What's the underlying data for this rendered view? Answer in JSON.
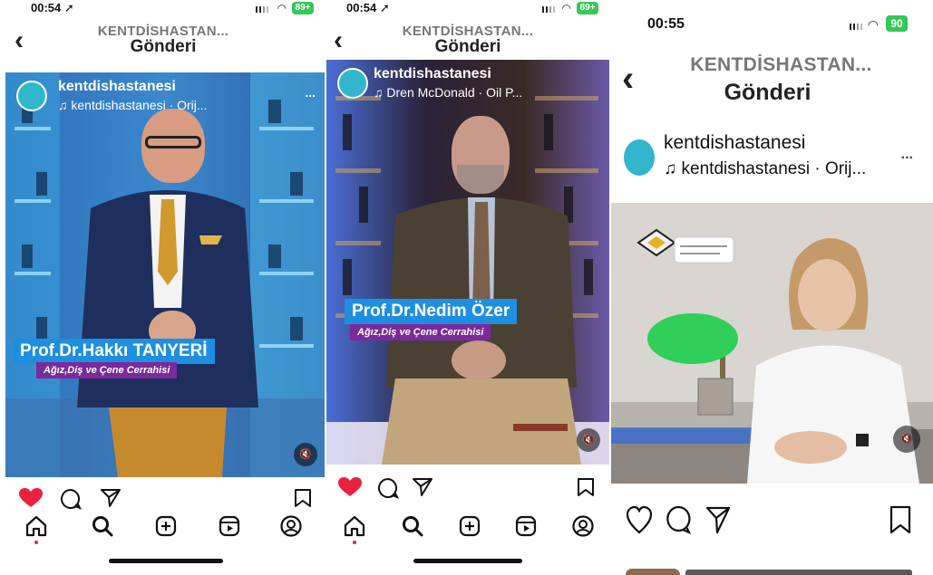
{
  "panel1": {
    "status": {
      "time": "00:54 ➚",
      "battery": "89+"
    },
    "nav": {
      "account": "KENTDİSHASTAN...",
      "title": "Gönderi"
    },
    "post": {
      "username": "kentdishastanesi",
      "audio": "♫ kentdishastanesi · Orij...",
      "more": "...",
      "name_tag": "Prof.Dr.Hakkı  TANYERİ",
      "subtitle": "Ağız,Diş ve Çene  Cerrahisi",
      "mute": "🔇"
    }
  },
  "panel2": {
    "status": {
      "time": "00:54 ➚",
      "battery": "89+"
    },
    "nav": {
      "account": "KENTDİSHASTAN...",
      "title": "Gönderi"
    },
    "post": {
      "username": "kentdishastanesi",
      "audio": "♫ Dren McDonald · Oil P...",
      "name_tag": "Prof.Dr.Nedim Özer",
      "subtitle": "Ağız,Diş ve Çene Cerrahisi",
      "mute": "🔇"
    }
  },
  "panel3": {
    "status": {
      "time": "00:55",
      "battery": "90"
    },
    "nav": {
      "account": "KENTDİSHASTAN...",
      "title": "Gönderi"
    },
    "post": {
      "username": "kentdishastanesi",
      "audio": "♫ kentdishastanesi · Orij...",
      "more": "...",
      "mute": "🔇"
    }
  },
  "colors": {
    "like": "#e8213e",
    "accent": "#1e8fe0",
    "subtitle_bg": "#7a2a9a",
    "avatar": "#32b6cc",
    "battery": "#34c759"
  }
}
